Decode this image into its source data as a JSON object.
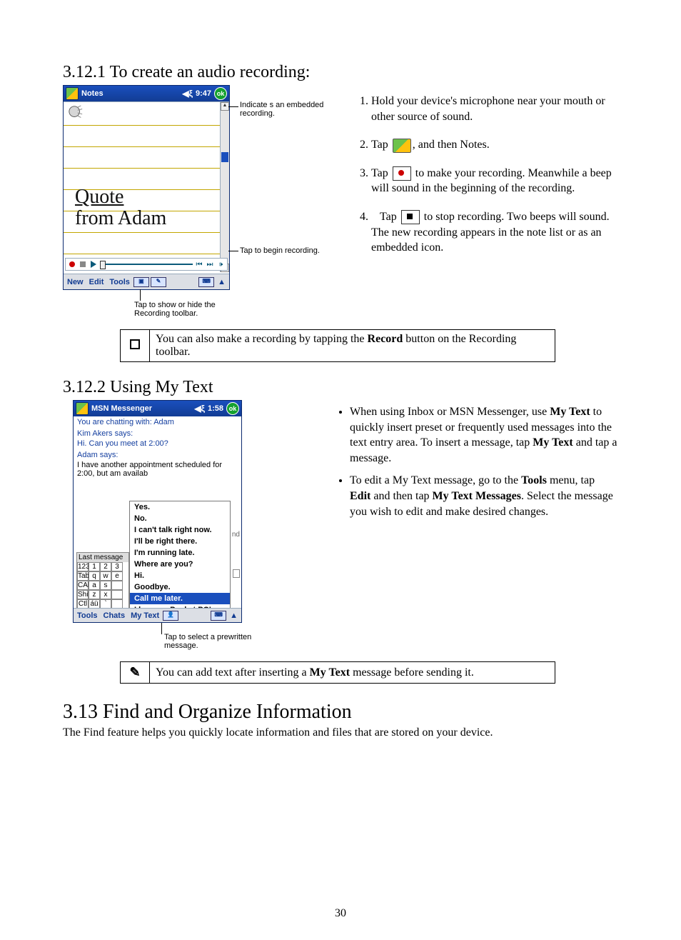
{
  "section_3_12_1_title": "3.12.1  To create an audio recording:",
  "notes_screenshot": {
    "title": "Notes",
    "clock": "9:47",
    "ok": "ok",
    "handwriting_line1": "Quote",
    "handwriting_line2": "from Adam",
    "menubar": {
      "new": "New",
      "edit": "Edit",
      "tools": "Tools"
    },
    "callout_embedded": "Indicate s an embedded recording.",
    "callout_tap_begin": "Tap to begin recording.",
    "callout_tap_show": "Tap to show or hide the Recording toolbar."
  },
  "steps_3_12_1": {
    "s1": "Hold your device's microphone near your mouth or other source of sound.",
    "s2_a": "Tap ",
    "s2_b": ", and then Notes.",
    "s3_a": "Tap ",
    "s3_b": " to make your recording. Meanwhile a beep will sound in the beginning of the recording.",
    "s4_a": "Tap ",
    "s4_b": " to stop recording. Two beeps will sound. The new recording appears in the note list or as an embedded icon."
  },
  "note_3_12_1_a": "You can also make a recording by tapping the ",
  "note_3_12_1_bold": "Record",
  "note_3_12_1_b": " button on the Recording toolbar.",
  "section_3_12_2_title": "3.12.2  Using My Text",
  "msn_screenshot": {
    "title": "MSN Messenger",
    "clock": "1:58",
    "ok": "ok",
    "chat_header": "You are chatting with: Adam",
    "kim_says": "Kim Akers says:",
    "kim_msg": "Hi. Can you meet at 2:00?",
    "adam_says": "Adam says:",
    "adam_msg": "I have another appointment scheduled for 2:00, but am availab",
    "last_msg_label": "Last message",
    "popup": [
      "Yes.",
      "No.",
      "I can't talk right now.",
      "I'll be right there.",
      "I'm running late.",
      "Where are you?",
      "Hi.",
      "Goodbye.",
      "Call me later.",
      "I love my Pocket PC!"
    ],
    "selected_index": 8,
    "kb_rows": {
      "r1": [
        "123",
        "1",
        "2",
        "3"
      ],
      "r2": [
        "Tab",
        "q",
        "w",
        "e"
      ],
      "r3": [
        "CAP",
        "a",
        "s",
        " "
      ],
      "r4": [
        "Shift",
        "z",
        "x",
        " "
      ],
      "r5": [
        "Ctl",
        "áü",
        "`",
        " "
      ]
    },
    "menubar": {
      "tools": "Tools",
      "chats": "Chats",
      "mytext": "My Text"
    },
    "callout": "Tap to select a prewritten message."
  },
  "bullets_3_12_2": {
    "b1_a": "When using Inbox or MSN Messenger, use ",
    "b1_bold1": "My Text",
    "b1_b": " to quickly insert preset or frequently used messages into the text entry area. To insert a message, tap ",
    "b1_bold2": "My Text",
    "b1_c": " and tap a message.",
    "b2_a": "To edit a My Text message, go to the ",
    "b2_bold1": "Tools",
    "b2_b": " menu, tap ",
    "b2_bold2": "Edit",
    "b2_c": " and then tap ",
    "b2_bold3": "My Text Messages",
    "b2_d": ". Select the message you wish to edit and make desired changes."
  },
  "note_3_12_2_a": "You can add text after inserting a ",
  "note_3_12_2_bold": "My Text",
  "note_3_12_2_b": " message before sending it.",
  "section_3_13_title": "3.13 Find and Organize Information",
  "section_3_13_body": "The Find feature helps you quickly locate information and files that are stored on your device.",
  "page_number": "30"
}
